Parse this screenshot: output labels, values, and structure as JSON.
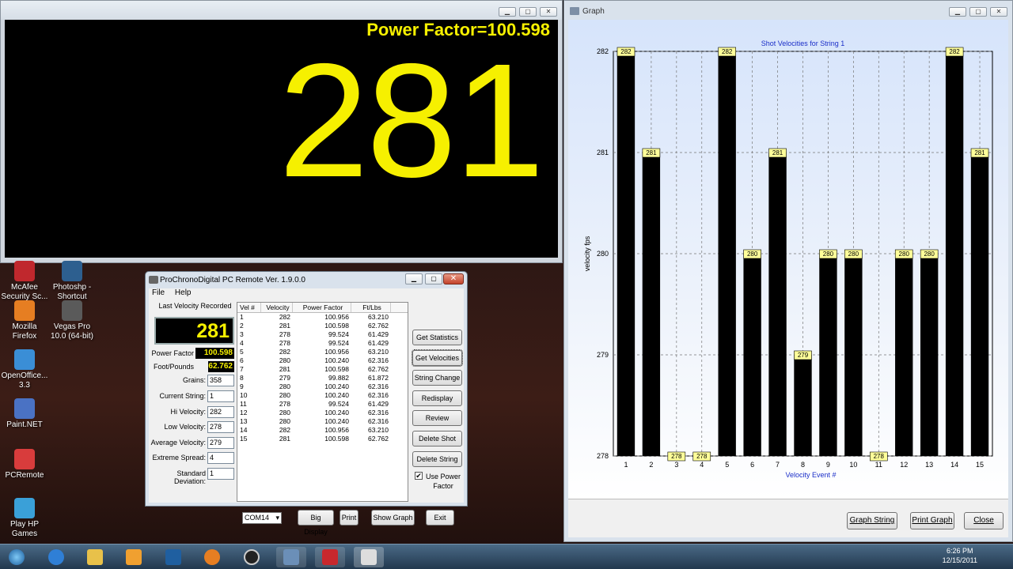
{
  "big_display": {
    "power_factor_text": "Power Factor=100.598",
    "velocity": "281",
    "window_buttons": [
      "▁",
      "▢",
      "✕"
    ]
  },
  "desktop_icons": [
    {
      "label": "McAfee Security Sc...",
      "color": "#c0282d"
    },
    {
      "label": "Photoshp - Shortcut",
      "color": "#2d5f8f"
    },
    {
      "label": "Mozilla Firefox",
      "color": "#e67e22"
    },
    {
      "label": "Vegas Pro 10.0 (64-bit)",
      "color": "#5a5a5a"
    },
    {
      "label": "OpenOffice... 3.3",
      "color": "#3a8ed6"
    },
    {
      "label": "Paint.NET",
      "color": "#4a72c4"
    },
    {
      "label": "PCRemote",
      "color": "#d83c3c"
    },
    {
      "label": "Play HP Games",
      "color": "#3aa0d8"
    }
  ],
  "prochrono": {
    "title": "ProChronoDigital PC Remote Ver. 1.9.0.0",
    "menu": [
      "File",
      "Help"
    ],
    "last_velocity_label": "Last Velocity Recorded",
    "last_velocity": "281",
    "power_factor_label": "Power Factor",
    "power_factor": "100.598",
    "foot_pounds_label": "Foot/Pounds",
    "foot_pounds": "62.762",
    "fields": [
      {
        "label": "Grains:",
        "value": "358"
      },
      {
        "label": "Current String:",
        "value": "1"
      },
      {
        "label": "Hi Velocity:",
        "value": "282"
      },
      {
        "label": "Low Velocity:",
        "value": "278"
      },
      {
        "label": "Average Velocity:",
        "value": "279"
      },
      {
        "label": "Extreme Spread:",
        "value": "4"
      },
      {
        "label": "Standard Deviation:",
        "value": "1"
      }
    ],
    "table_headers": [
      "Vel #",
      "Velocity",
      "Power Factor",
      "Ft/Lbs"
    ],
    "rows": [
      [
        "1",
        "282",
        "100.956",
        "63.210"
      ],
      [
        "2",
        "281",
        "100.598",
        "62.762"
      ],
      [
        "3",
        "278",
        "99.524",
        "61.429"
      ],
      [
        "4",
        "278",
        "99.524",
        "61.429"
      ],
      [
        "5",
        "282",
        "100.956",
        "63.210"
      ],
      [
        "6",
        "280",
        "100.240",
        "62.316"
      ],
      [
        "7",
        "281",
        "100.598",
        "62.762"
      ],
      [
        "8",
        "279",
        "99.882",
        "61.872"
      ],
      [
        "9",
        "280",
        "100.240",
        "62.316"
      ],
      [
        "10",
        "280",
        "100.240",
        "62.316"
      ],
      [
        "11",
        "278",
        "99.524",
        "61.429"
      ],
      [
        "12",
        "280",
        "100.240",
        "62.316"
      ],
      [
        "13",
        "280",
        "100.240",
        "62.316"
      ],
      [
        "14",
        "282",
        "100.956",
        "63.210"
      ],
      [
        "15",
        "281",
        "100.598",
        "62.762"
      ]
    ],
    "buttons": [
      "Get Statistics",
      "Get Velocities",
      "String Change",
      "Redisplay",
      "Review",
      "Delete Shot",
      "Delete String"
    ],
    "use_power_factor_label": "Use Power Factor",
    "use_power_factor_checked": "✔",
    "com_port": "COM14",
    "bottom_buttons": [
      "Big Display",
      "Print",
      "Show Graph",
      "Exit"
    ]
  },
  "graph_window": {
    "title": "Graph",
    "buttons": [
      "Graph String",
      "Print Graph",
      "Close"
    ]
  },
  "chart_data": {
    "type": "bar",
    "title": "Shot Velocities for String 1",
    "xlabel": "Velocity Event #",
    "ylabel": "velocity fps",
    "categories": [
      "1",
      "2",
      "3",
      "4",
      "5",
      "6",
      "7",
      "8",
      "9",
      "10",
      "11",
      "12",
      "13",
      "14",
      "15"
    ],
    "values": [
      282,
      281,
      278,
      278,
      282,
      280,
      281,
      279,
      280,
      280,
      278,
      280,
      280,
      282,
      281
    ],
    "ylim": [
      278,
      282
    ],
    "yticks": [
      "278",
      "279",
      "280",
      "281",
      "282"
    ],
    "grid": true,
    "bar_color": "#000000",
    "label_bg": "#ffff99"
  },
  "taskbar": {
    "time": "6:26 PM",
    "date": "12/15/2011"
  }
}
